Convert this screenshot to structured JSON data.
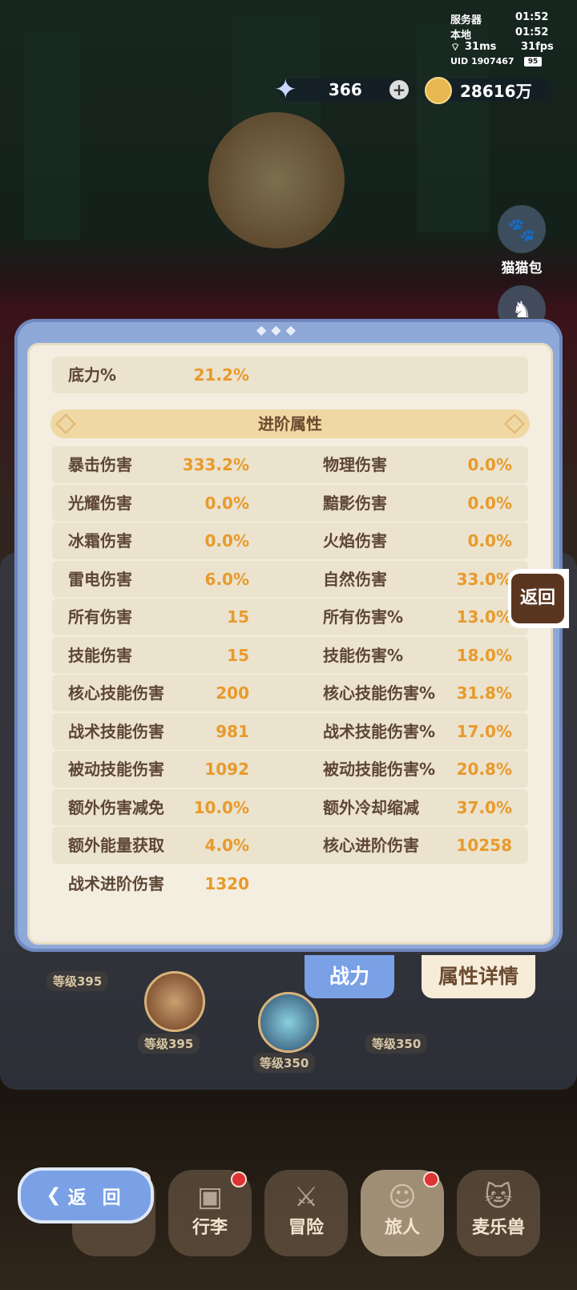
{
  "status": {
    "server_label": "服务器",
    "server_time": "01:52",
    "local_label": "本地",
    "local_time": "01:52",
    "ping": "31ms",
    "fps": "31fps",
    "uid": "UID 1907467",
    "battery": "95"
  },
  "resources": {
    "stars": "366",
    "coins": "28616万"
  },
  "side_buttons": {
    "cat_bag": "猫猫包",
    "return_side": "返回"
  },
  "bg_levels": [
    "等级395",
    "等级395",
    "等级350",
    "等级350"
  ],
  "top_row": {
    "label": "底力%",
    "value": "21.2%"
  },
  "section_title": "进阶属性",
  "attributes": [
    {
      "l1": "暴击伤害",
      "v1": "333.2%",
      "l2": "物理伤害",
      "v2": "0.0%"
    },
    {
      "l1": "光耀伤害",
      "v1": "0.0%",
      "l2": "黯影伤害",
      "v2": "0.0%"
    },
    {
      "l1": "冰霜伤害",
      "v1": "0.0%",
      "l2": "火焰伤害",
      "v2": "0.0%"
    },
    {
      "l1": "雷电伤害",
      "v1": "6.0%",
      "l2": "自然伤害",
      "v2": "33.0%"
    },
    {
      "l1": "所有伤害",
      "v1": "15",
      "l2": "所有伤害%",
      "v2": "13.0%"
    },
    {
      "l1": "技能伤害",
      "v1": "15",
      "l2": "技能伤害%",
      "v2": "18.0%"
    },
    {
      "l1": "核心技能伤害",
      "v1": "200",
      "l2": "核心技能伤害%",
      "v2": "31.8%"
    },
    {
      "l1": "战术技能伤害",
      "v1": "981",
      "l2": "战术技能伤害%",
      "v2": "17.0%"
    },
    {
      "l1": "被动技能伤害",
      "v1": "1092",
      "l2": "被动技能伤害%",
      "v2": "20.8%"
    },
    {
      "l1": "额外伤害减免",
      "v1": "10.0%",
      "l2": "额外冷却缩减",
      "v2": "37.0%"
    },
    {
      "l1": "额外能量获取",
      "v1": "4.0%",
      "l2": "核心进阶伤害",
      "v2": "10258"
    },
    {
      "l1": "战术进阶伤害",
      "v1": "1320",
      "l2": "",
      "v2": ""
    }
  ],
  "tabs": {
    "power": "战力",
    "detail": "属性详情"
  },
  "back_button": "返 回",
  "nav": [
    {
      "label": "",
      "icon": "crown-icon",
      "dot": true
    },
    {
      "label": "行李",
      "icon": "luggage-icon",
      "dot": true
    },
    {
      "label": "冒险",
      "icon": "swords-icon",
      "dot": false
    },
    {
      "label": "旅人",
      "icon": "traveler-icon",
      "dot": true
    },
    {
      "label": "麦乐兽",
      "icon": "cat-icon",
      "dot": false
    }
  ]
}
